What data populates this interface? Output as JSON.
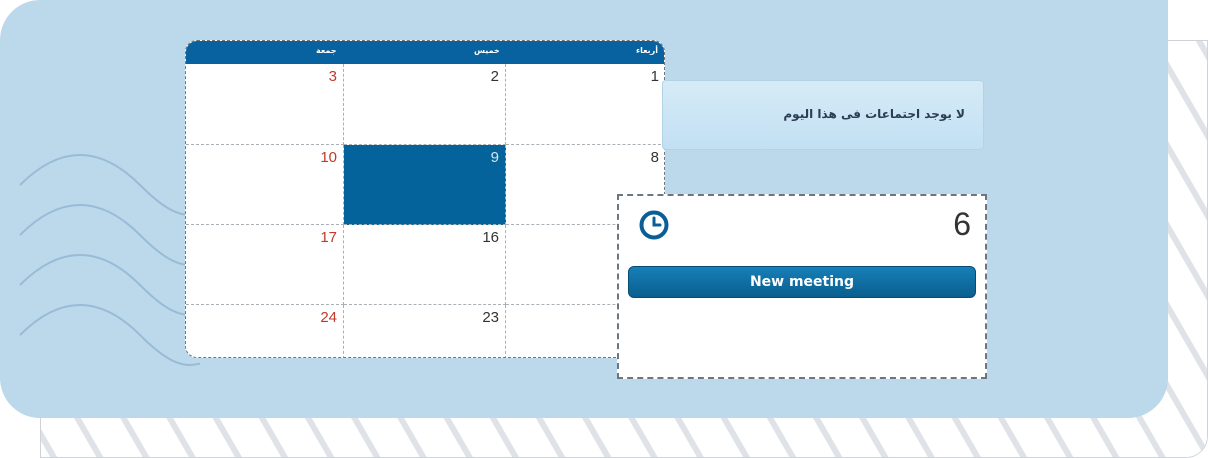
{
  "calendar": {
    "weekdays": [
      "جمعة",
      "خميس",
      "أربعاء"
    ],
    "rows": [
      {
        "fri": "3",
        "thu": "2",
        "wed": "1"
      },
      {
        "fri": "10",
        "thu": "9",
        "wed": "8"
      },
      {
        "fri": "17",
        "thu": "16",
        "wed": ""
      },
      {
        "fri": "24",
        "thu": "23",
        "wed": ""
      }
    ],
    "selected_day": "9"
  },
  "notice": {
    "text": "لا يوجد اجتماعات فى هذا اليوم"
  },
  "detail": {
    "day": "6",
    "icon": "clock-icon",
    "new_meeting_label": "New meeting"
  },
  "colors": {
    "header": "#08629f",
    "friday": "#c0392b",
    "panel": "#bcd9ec"
  }
}
